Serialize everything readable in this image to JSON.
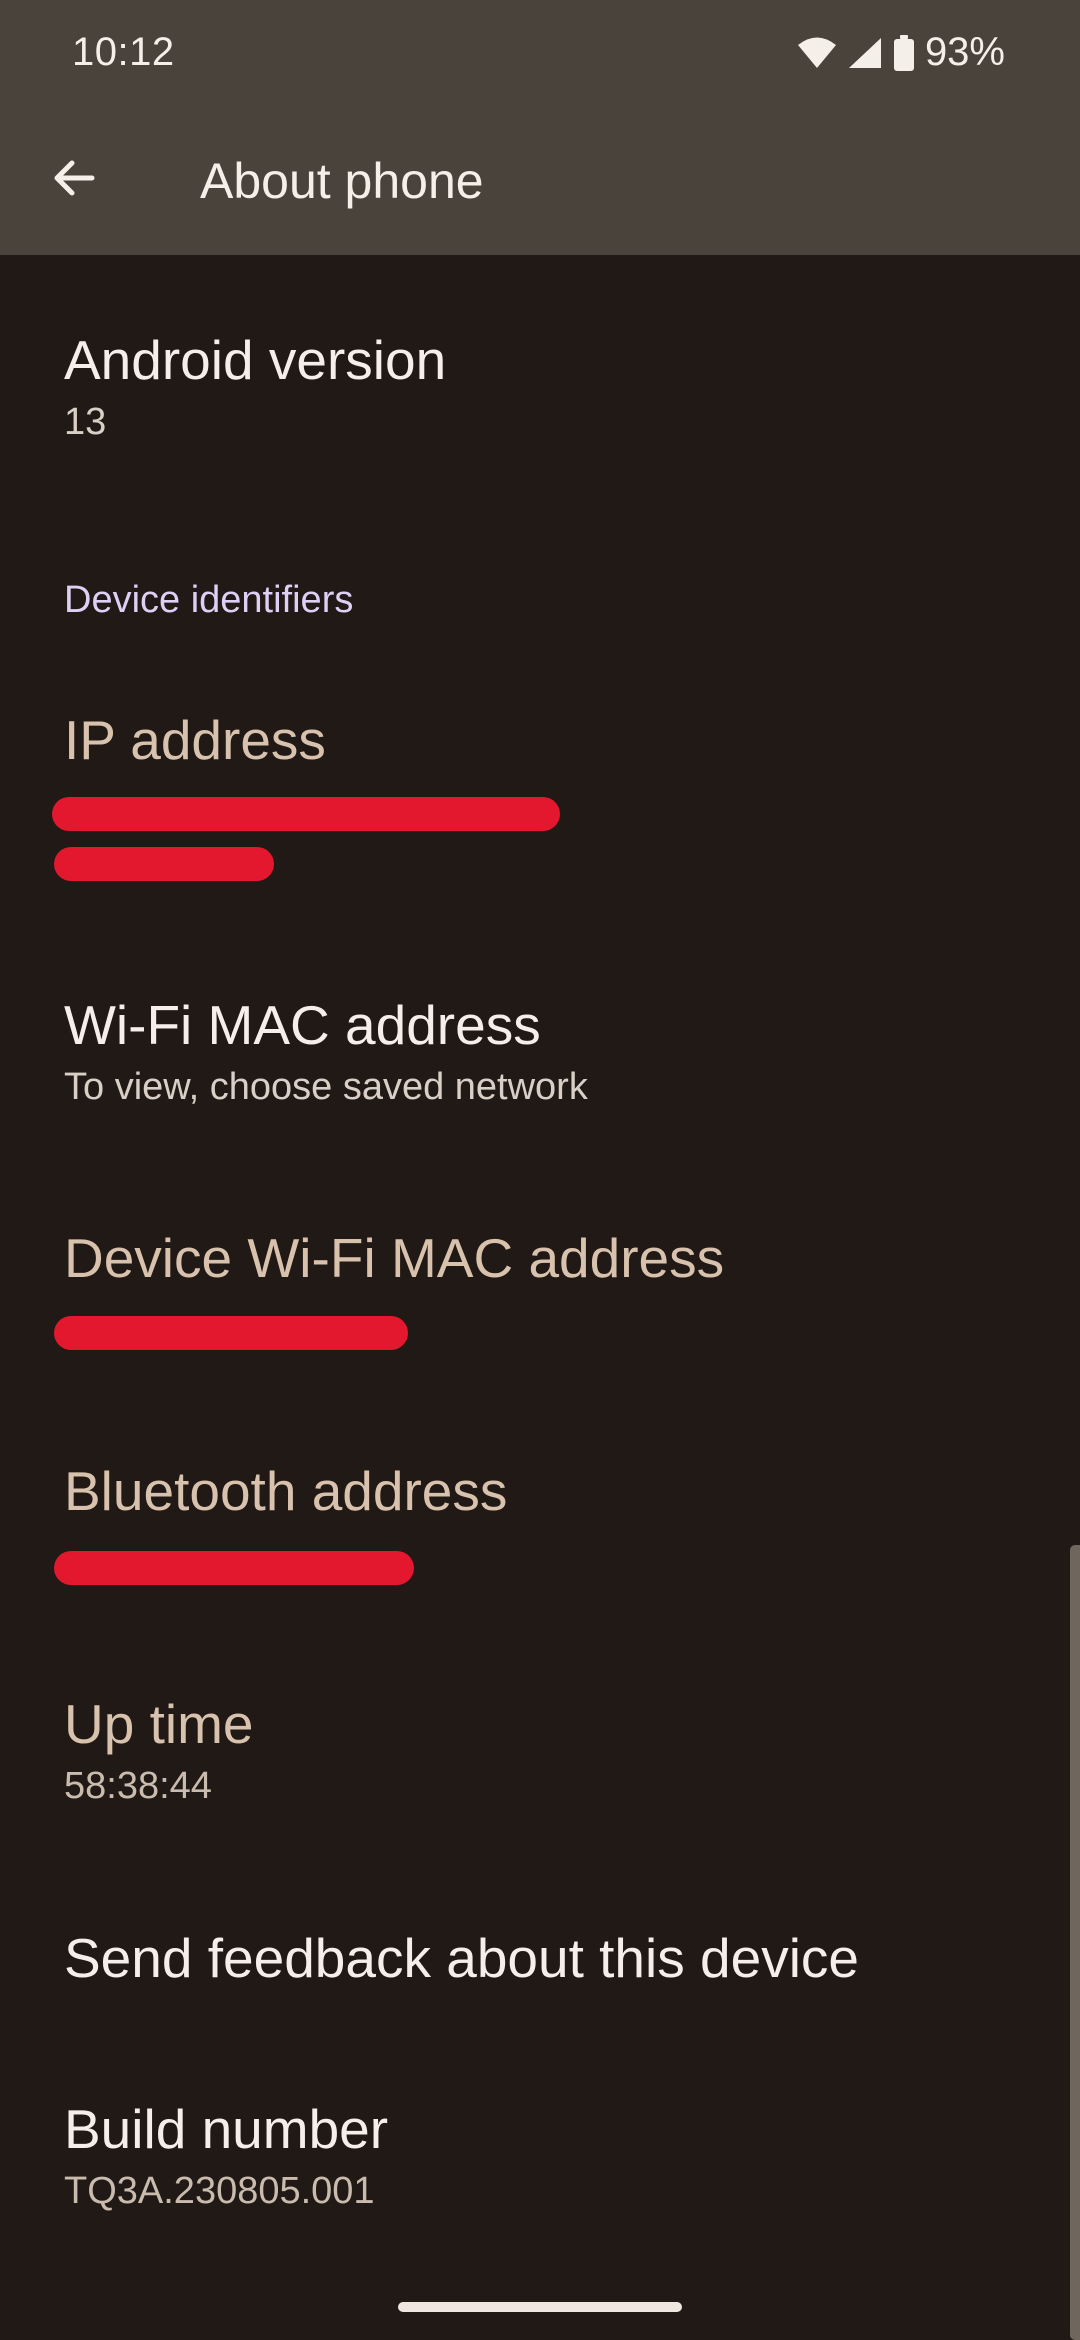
{
  "status_bar": {
    "time": "10:12",
    "battery": "93%",
    "icons": [
      "wifi-icon",
      "cell-signal-icon",
      "battery-icon"
    ]
  },
  "app_bar": {
    "title": "About phone",
    "back_icon": "arrow-back-icon"
  },
  "items": {
    "android_version": {
      "title": "Android version",
      "value": "13"
    },
    "section_header": "Device identifiers",
    "ip_address": {
      "title": "IP address"
    },
    "wifi_mac": {
      "title": "Wi-Fi MAC address",
      "value": "To view, choose saved network"
    },
    "device_wifi_mac": {
      "title": "Device Wi-Fi MAC address"
    },
    "bluetooth": {
      "title": "Bluetooth address"
    },
    "up_time": {
      "title": "Up time",
      "value": "58:38:44"
    },
    "send_feedback": {
      "title": "Send feedback about this device"
    },
    "build_number": {
      "title": "Build number",
      "value": "TQ3A.230805.001"
    }
  },
  "colors": {
    "background": "#211915",
    "app_bar": "#4a433c",
    "section_header": "#dcd0f5",
    "redaction": "#e3182e"
  }
}
